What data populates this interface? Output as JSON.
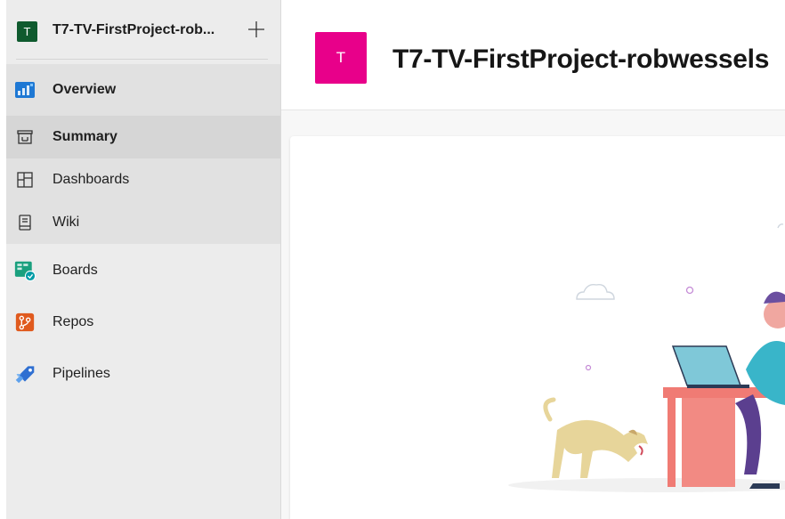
{
  "project": {
    "initial": "T",
    "name_truncated": "T7-TV-FirstProject-rob...",
    "name_full": "T7-TV-FirstProject-robwessels"
  },
  "nav": {
    "overview": "Overview",
    "summary": "Summary",
    "dashboards": "Dashboards",
    "wiki": "Wiki",
    "boards": "Boards",
    "repos": "Repos",
    "pipelines": "Pipelines"
  },
  "icons": {
    "add": "plus-icon",
    "overview": "overview-icon",
    "summary": "summary-icon",
    "dashboards": "dashboards-icon",
    "wiki": "wiki-icon",
    "boards": "boards-icon",
    "repos": "repos-icon",
    "pipelines": "pipelines-icon"
  },
  "colors": {
    "project_avatar_small": "#0f5a2e",
    "project_avatar_large": "#e8008a",
    "boards_accent": "#009ca6",
    "repos_accent": "#e05a1e",
    "pipelines_accent": "#2f6fd1",
    "overview_accent": "#1e78d4"
  }
}
